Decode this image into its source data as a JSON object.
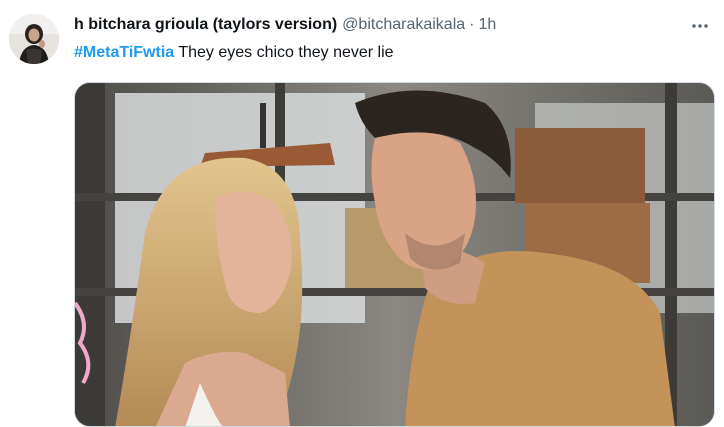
{
  "tweet": {
    "display_name": "h bitchara grioula (taylors version)",
    "handle": "@bitcharakaikala",
    "separator": "·",
    "time": "1h",
    "hashtag": "#MetaTiFwtia",
    "text": " They eyes chico they never lie",
    "avatar_icon": "user-avatar",
    "more_icon": "more-options-icon",
    "media": {
      "description_icon": "tv-still-image"
    }
  },
  "colors": {
    "link": "#1d9bf0",
    "secondary_text": "#536471",
    "primary_text": "#0f1419"
  }
}
